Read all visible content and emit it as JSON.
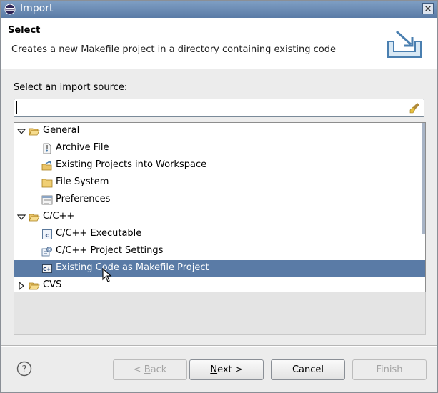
{
  "window": {
    "title": "Import"
  },
  "header": {
    "title": "Select",
    "description": "Creates a new Makefile project in a directory containing existing code"
  },
  "source": {
    "label_mnemonic": "S",
    "label_rest": "elect an import source:",
    "filter_value": "",
    "filter_placeholder": ""
  },
  "tree": {
    "items": [
      {
        "label": "General",
        "level": 0,
        "expanded": true,
        "icon": "folder-open-icon"
      },
      {
        "label": "Archive File",
        "level": 1,
        "icon": "archive-file-icon"
      },
      {
        "label": "Existing Projects into Workspace",
        "level": 1,
        "icon": "existing-projects-icon"
      },
      {
        "label": "File System",
        "level": 1,
        "icon": "folder-icon"
      },
      {
        "label": "Preferences",
        "level": 1,
        "icon": "preferences-icon"
      },
      {
        "label": "C/C++",
        "level": 0,
        "expanded": true,
        "icon": "folder-open-icon"
      },
      {
        "label": "C/C++ Executable",
        "level": 1,
        "icon": "c-executable-icon"
      },
      {
        "label": "C/C++ Project Settings",
        "level": 1,
        "icon": "c-project-settings-icon"
      },
      {
        "label": "Existing Code as Makefile Project",
        "level": 1,
        "icon": "makefile-project-icon",
        "selected": true
      },
      {
        "label": "CVS",
        "level": 0,
        "expanded": false,
        "icon": "folder-open-icon"
      }
    ]
  },
  "buttons": {
    "back": {
      "prefix": "< ",
      "mnemonic": "B",
      "rest": "ack",
      "enabled": false
    },
    "next": {
      "mnemonic": "N",
      "rest": "ext >",
      "enabled": true
    },
    "cancel": {
      "label": "Cancel",
      "enabled": true
    },
    "finish": {
      "label": "Finish",
      "enabled": false
    }
  },
  "colors": {
    "selection": "#5a7ba6",
    "titlebar": "#5a7ba6"
  }
}
